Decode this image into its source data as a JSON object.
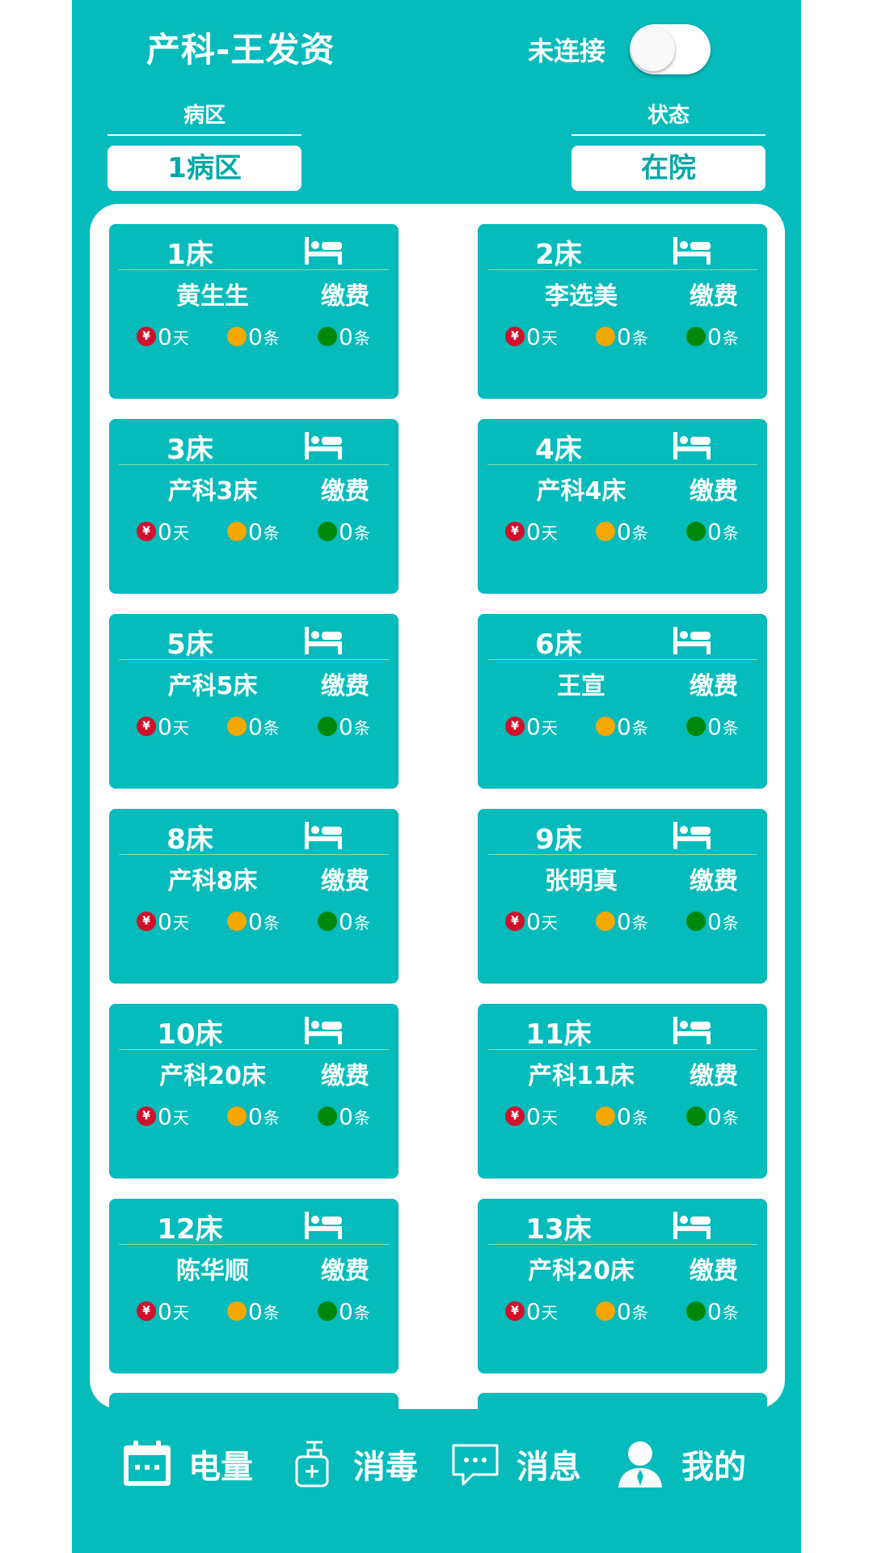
{
  "header": {
    "title": "产科-王发资",
    "connection_status": "未连接"
  },
  "filters": {
    "ward": {
      "label": "病区",
      "value": "1病区"
    },
    "status": {
      "label": "状态",
      "value": "在院"
    }
  },
  "beds": [
    {
      "bed": "1床",
      "patient": "黄生生",
      "pay": "缴费",
      "red": "0",
      "red_unit": "天",
      "orange": "0",
      "orange_unit": "条",
      "green": "0",
      "green_unit": "条"
    },
    {
      "bed": "2床",
      "patient": "李选美",
      "pay": "缴费",
      "red": "0",
      "red_unit": "天",
      "orange": "0",
      "orange_unit": "条",
      "green": "0",
      "green_unit": "条"
    },
    {
      "bed": "3床",
      "patient": "产科3床",
      "pay": "缴费",
      "red": "0",
      "red_unit": "天",
      "orange": "0",
      "orange_unit": "条",
      "green": "0",
      "green_unit": "条"
    },
    {
      "bed": "4床",
      "patient": "产科4床",
      "pay": "缴费",
      "red": "0",
      "red_unit": "天",
      "orange": "0",
      "orange_unit": "条",
      "green": "0",
      "green_unit": "条"
    },
    {
      "bed": "5床",
      "patient": "产科5床",
      "pay": "缴费",
      "red": "0",
      "red_unit": "天",
      "orange": "0",
      "orange_unit": "条",
      "green": "0",
      "green_unit": "条"
    },
    {
      "bed": "6床",
      "patient": "王宣",
      "pay": "缴费",
      "red": "0",
      "red_unit": "天",
      "orange": "0",
      "orange_unit": "条",
      "green": "0",
      "green_unit": "条"
    },
    {
      "bed": "8床",
      "patient": "产科8床",
      "pay": "缴费",
      "red": "0",
      "red_unit": "天",
      "orange": "0",
      "orange_unit": "条",
      "green": "0",
      "green_unit": "条"
    },
    {
      "bed": "9床",
      "patient": "张明真",
      "pay": "缴费",
      "red": "0",
      "red_unit": "天",
      "orange": "0",
      "orange_unit": "条",
      "green": "0",
      "green_unit": "条"
    },
    {
      "bed": "10床",
      "patient": "产科20床",
      "pay": "缴费",
      "red": "0",
      "red_unit": "天",
      "orange": "0",
      "orange_unit": "条",
      "green": "0",
      "green_unit": "条"
    },
    {
      "bed": "11床",
      "patient": "产科11床",
      "pay": "缴费",
      "red": "0",
      "red_unit": "天",
      "orange": "0",
      "orange_unit": "条",
      "green": "0",
      "green_unit": "条"
    },
    {
      "bed": "12床",
      "patient": "陈华顺",
      "pay": "缴费",
      "red": "0",
      "red_unit": "天",
      "orange": "0",
      "orange_unit": "条",
      "green": "0",
      "green_unit": "条"
    },
    {
      "bed": "13床",
      "patient": "产科20床",
      "pay": "缴费",
      "red": "0",
      "red_unit": "天",
      "orange": "0",
      "orange_unit": "条",
      "green": "0",
      "green_unit": "条"
    }
  ],
  "nav": [
    {
      "label": "电量",
      "icon": "calendar-icon"
    },
    {
      "label": "消毒",
      "icon": "sanitizer-icon"
    },
    {
      "label": "消息",
      "icon": "message-icon"
    },
    {
      "label": "我的",
      "icon": "user-icon"
    }
  ],
  "colors": {
    "primary": "#05BBBB",
    "red": "#D0112B",
    "orange": "#F5A800",
    "green": "#00880C"
  }
}
